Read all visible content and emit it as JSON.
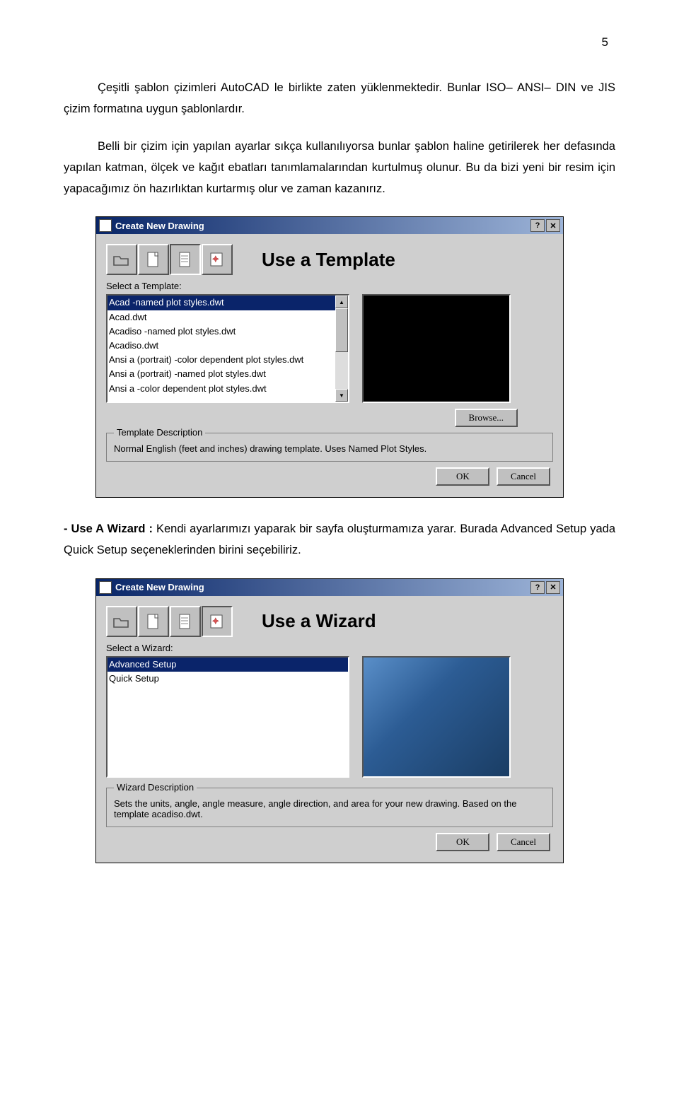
{
  "page_number": "5",
  "para1": "Çeşitli şablon çizimleri AutoCAD le birlikte zaten yüklenmektedir. Bunlar ISO– ANSI– DIN ve JIS çizim formatına uygun şablonlardır.",
  "para2": "Belli bir çizim için yapılan ayarlar sıkça kullanılıyorsa bunlar şablon haline getirilerek her defasında yapılan katman, ölçek ve kağıt ebatları tanımlamalarından kurtulmuş olunur. Bu da bizi yeni bir resim için yapacağımız ön hazırlıktan kurtarmış olur ve zaman kazanırız.",
  "para3_label": "- Use A Wizard",
  "para3_sep": " : ",
  "para3_rest": "Kendi ayarlarımızı yaparak bir sayfa oluşturmamıza yarar. Burada Advanced Setup yada Quick Setup seçeneklerinden birini seçebiliriz.",
  "dialog1": {
    "title": "Create New Drawing",
    "heading": "Use a Template",
    "select_label": "Select a Template:",
    "items": {
      "i0": "Acad -named plot styles.dwt",
      "i1": "Acad.dwt",
      "i2": "Acadiso -named plot styles.dwt",
      "i3": "Acadiso.dwt",
      "i4": "Ansi a (portrait) -color dependent plot styles.dwt",
      "i5": "Ansi a (portrait) -named plot styles.dwt",
      "i6": "Ansi a -color dependent plot styles.dwt"
    },
    "browse": "Browse...",
    "group_title": "Template Description",
    "group_text": "Normal English (feet and inches) drawing template.  Uses Named Plot Styles.",
    "ok": "OK",
    "cancel": "Cancel",
    "help": "?",
    "close": "✕"
  },
  "dialog2": {
    "title": "Create New Drawing",
    "heading": "Use a Wizard",
    "select_label": "Select a Wizard:",
    "items": {
      "i0": "Advanced Setup",
      "i1": "Quick Setup"
    },
    "group_title": "Wizard Description",
    "group_text": "Sets the units, angle, angle measure, angle direction, and area for your new drawing. Based on the template acadiso.dwt.",
    "ok": "OK",
    "cancel": "Cancel",
    "help": "?",
    "close": "✕"
  }
}
